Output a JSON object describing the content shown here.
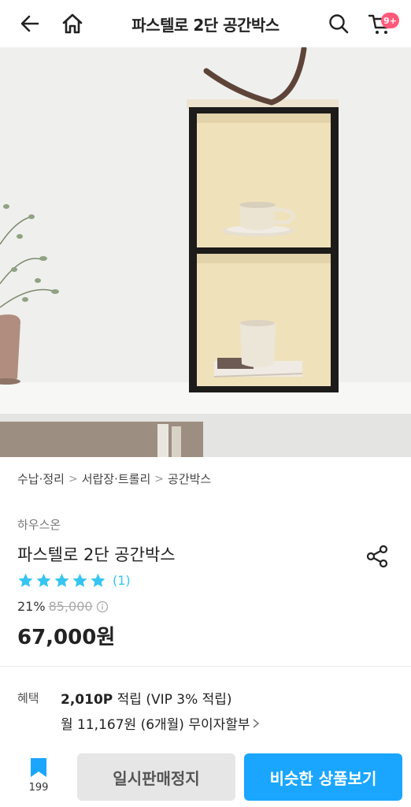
{
  "header": {
    "title": "파스텔로 2단 공간박스",
    "back_icon": "back-arrow-icon",
    "home_icon": "home-icon",
    "search_icon": "search-icon",
    "cart_icon": "cart-icon",
    "cart_badge": "9+"
  },
  "hero": {
    "image": "product-photo"
  },
  "breadcrumb": {
    "items": [
      "수납·정리",
      "서랍장·트롤리",
      "공간박스"
    ],
    "separator": ">"
  },
  "product": {
    "brand": "하우스온",
    "name": "파스텔로 2단 공간박스",
    "rating": 5,
    "review_count": "(1)",
    "discount": "21%",
    "original_price": "85,000",
    "sale_price": "67,000원",
    "star_color": "#35c5f0"
  },
  "benefit": {
    "label": "혜택",
    "points_value": "2,010P",
    "points_text": " 적립 (VIP 3% 적립)",
    "installment": "월 11,167원 (6개월) 무이자할부"
  },
  "bottom_bar": {
    "bookmark_count": "199",
    "soldout_label": "일시판매정지",
    "similar_label": "비슷한 상품보기",
    "accent": "#1aa6ff"
  }
}
